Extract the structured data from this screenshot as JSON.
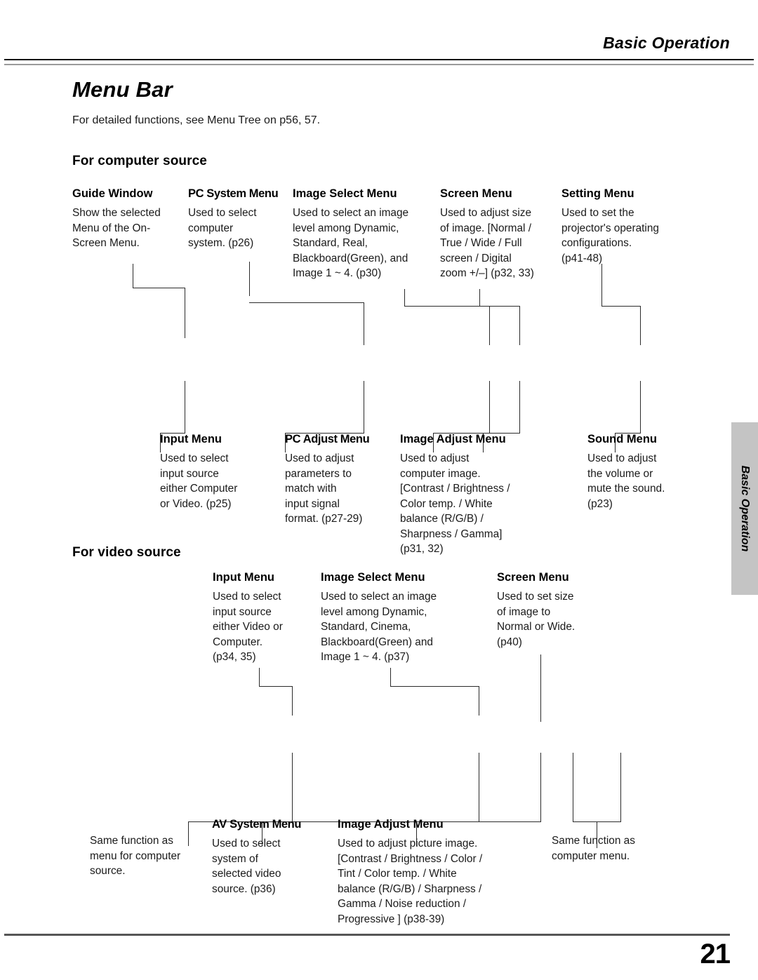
{
  "header": {
    "running_head": "Basic Operation"
  },
  "page": {
    "title": "Menu Bar",
    "intro": "For detailed functions, see Menu Tree on p56, 57.",
    "number": "21"
  },
  "side_tab": {
    "label": "Basic Operation"
  },
  "sections": [
    {
      "heading": "For computer source",
      "row1": [
        {
          "title": "Guide Window",
          "body": "Show the selected\nMenu of the On-\nScreen Menu."
        },
        {
          "title": "PC System Menu",
          "body": "Used to select\ncomputer\nsystem.  (p26)"
        },
        {
          "title": "Image Select Menu",
          "body": "Used to select an image\nlevel among Dynamic,\nStandard, Real,\nBlackboard(Green), and\nImage 1 ~ 4.  (p30)"
        },
        {
          "title": "Screen Menu",
          "body": "Used to adjust size\nof image.  [Normal /\nTrue / Wide / Full\nscreen / Digital\nzoom +/–]  (p32, 33)"
        },
        {
          "title": "Setting Menu",
          "body": "Used to set the\nprojector's operating\nconfigurations.\n (p41-48)"
        }
      ],
      "row2": [
        {
          "title": "Input Menu",
          "body": "Used to select\ninput source\neither Computer\nor Video.  (p25)"
        },
        {
          "title": "PC Adjust Menu",
          "body": "Used to adjust\nparameters to\nmatch with\ninput signal\nformat.  (p27-29)"
        },
        {
          "title": "Image Adjust Menu",
          "body": "Used to adjust\ncomputer image.\n[Contrast / Brightness /\nColor temp. / White\nbalance (R/G/B) /\nSharpness / Gamma]\n(p31, 32)"
        },
        {
          "title": "Sound Menu",
          "body": "Used to adjust\nthe volume or\nmute the sound.\n(p23)"
        }
      ]
    },
    {
      "heading": "For video source",
      "row1": [
        {
          "title": "Input Menu",
          "body": "Used to select\ninput source\neither Video or\nComputer.\n(p34, 35)"
        },
        {
          "title": "Image Select Menu",
          "body": "Used to select an image\nlevel among Dynamic,\nStandard, Cinema,\nBlackboard(Green) and\nImage 1 ~ 4.  (p37)"
        },
        {
          "title": "Screen Menu",
          "body": "Used to set size\nof image to\nNormal or Wide.\n(p40)"
        }
      ],
      "row2": [
        {
          "title": "",
          "body": "Same function as\nmenu for computer\nsource."
        },
        {
          "title": "AV System Menu",
          "body": "Used to select\nsystem of\nselected video\nsource.  (p36)"
        },
        {
          "title": "Image Adjust Menu",
          "body": "Used to adjust picture image.\n[Contrast / Brightness / Color /\nTint / Color temp. / White\nbalance (R/G/B) / Sharpness /\nGamma / Noise reduction /\nProgressive ]  (p38-39)"
        },
        {
          "title": "",
          "body": "Same function as\ncomputer menu."
        }
      ]
    }
  ]
}
